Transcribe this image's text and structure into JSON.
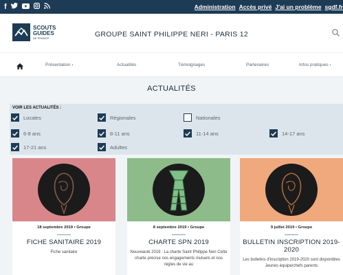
{
  "topbar": {
    "social_icons": [
      "facebook-icon",
      "twitter-icon",
      "youtube-icon",
      "instagram-icon",
      "rss-icon"
    ],
    "links": [
      "Administration",
      "Accès privé",
      "J'ai un problème",
      "sgdf.fr"
    ]
  },
  "header": {
    "logo": {
      "line1": "SCOUTS",
      "line2": "GUIDES",
      "line3": "DE FRANCE"
    },
    "title": "GROUPE SAINT PHILIPPE NERI - PARIS 12"
  },
  "nav": {
    "items": [
      "Présentation ›",
      "Actualités",
      "Témoignages",
      "Partenaires",
      "Infos pratiques ›"
    ]
  },
  "page": {
    "title": "ACTUALITÉS"
  },
  "filters": {
    "heading": "VOIR LES ACTUALITÉS :",
    "options": [
      {
        "label": "Locales",
        "checked": true
      },
      {
        "label": "Régionales",
        "checked": true
      },
      {
        "label": "Nationales",
        "checked": false
      },
      {
        "label": "6-8 ans",
        "checked": true
      },
      {
        "label": "8-11 ans",
        "checked": true
      },
      {
        "label": "11-14 ans",
        "checked": true
      },
      {
        "label": "14-17 ans",
        "checked": true
      },
      {
        "label": "17-21 ans",
        "checked": true
      },
      {
        "label": "Adultes",
        "checked": true
      }
    ]
  },
  "cards": [
    {
      "meta": "18 septembre 2019 • Groupe",
      "title": "FICHE SANITAIRE 2019",
      "body": "Fiche sanitaire",
      "bg": "#d9868a"
    },
    {
      "meta": "8 septembre 2019 • Groupe",
      "title": "CHARTE SPN 2019",
      "body": "Nouveauté 2019 : La charte Saint Philippe Neri Cette charte précise nos engagements mutuels et nos règles de vie au",
      "bg": "#8dbb8a"
    },
    {
      "meta": "9 juillet 2019 • Groupe",
      "title": "BULLETIN INSCRIPTION 2019-2020",
      "body": "Les bulletins d'inscription 2019-2020 sont disponibles Jeunes équipe/chefs parents",
      "bg": "#f0a97c"
    }
  ]
}
